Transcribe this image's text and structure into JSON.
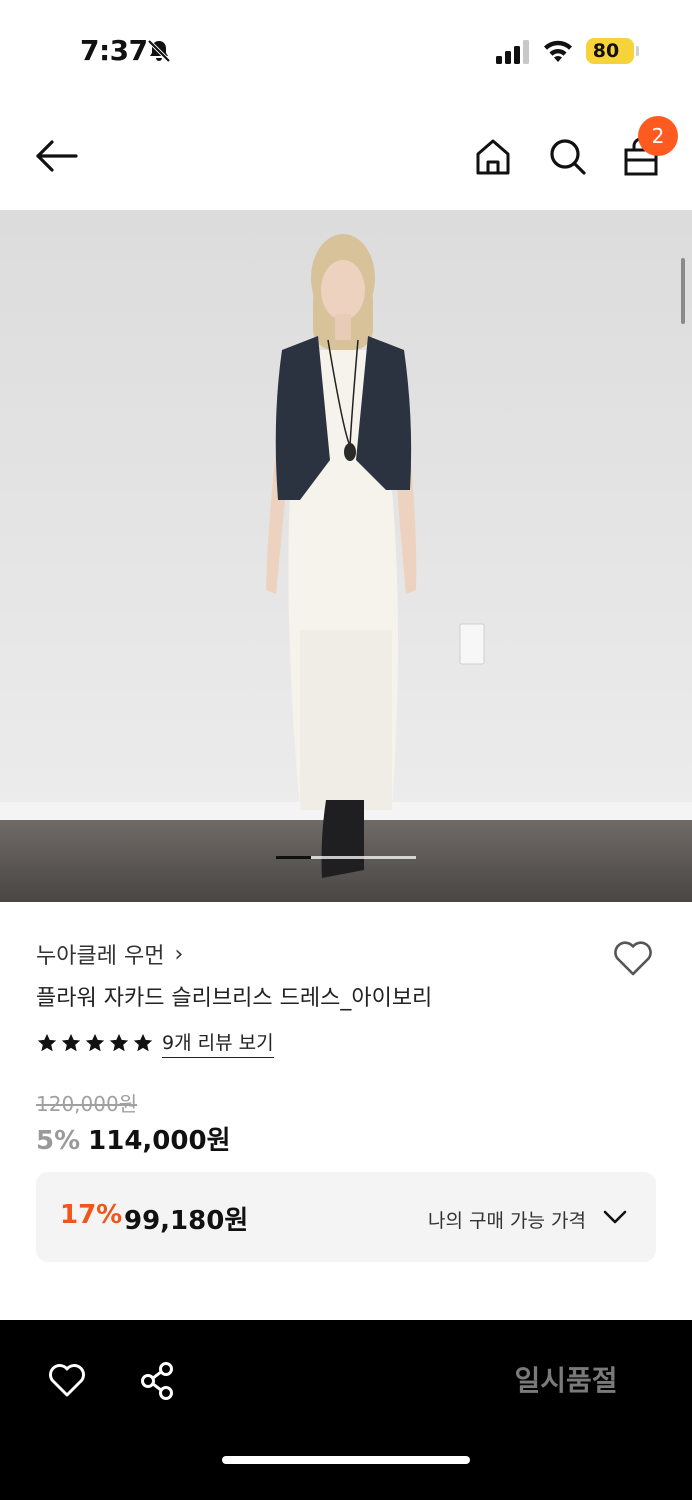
{
  "status_bar": {
    "time": "7:37",
    "battery": "80",
    "icons": [
      "bell-off-icon",
      "signal-icon",
      "wifi-icon",
      "battery-icon"
    ],
    "battery_color": "#f7d33a"
  },
  "header": {
    "icons": [
      "back-arrow-icon",
      "home-icon",
      "search-icon",
      "shopping-bag-icon"
    ],
    "cart_count": "2",
    "badge_color": "#ff5a1f"
  },
  "product": {
    "image_icon": "product-photo",
    "carousel_progress": 0.25,
    "brand": "누아클레 우먼",
    "brand_chevron": "›",
    "title": "플라워 자카드 슬리브리스 드레스_아이보리",
    "rating_stars": 5,
    "review_link": "9개 리뷰 보기",
    "original_price": "120,000원",
    "discount_rate": "5%",
    "sale_price": "114,000원"
  },
  "my_price": {
    "discount_rate": "17%",
    "price": "99,180원",
    "label": "나의 구매 가능 가격",
    "accent_color": "#f0561a"
  },
  "bottom_bar": {
    "icons": [
      "heart-icon",
      "share-icon"
    ],
    "soldout_label": "일시품절"
  }
}
